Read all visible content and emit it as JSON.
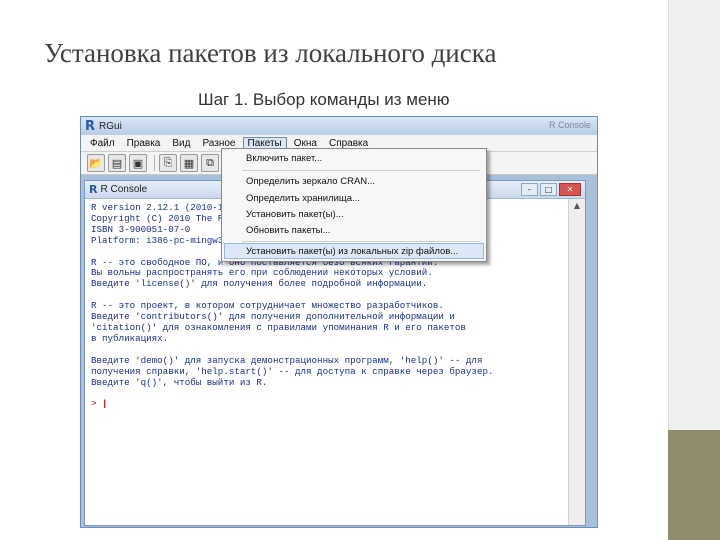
{
  "slide": {
    "title": "Установка пакетов из локального диска",
    "subtitle": "Шаг 1. Выбор команды из меню"
  },
  "rgui": {
    "title": "RGui",
    "title_right": "R Console",
    "menu": [
      "Файл",
      "Правка",
      "Вид",
      "Разное",
      "Пакеты",
      "Окна",
      "Справка"
    ],
    "active_menu": "Пакеты",
    "toolbar_icons": [
      "open-script-icon",
      "load-workspace-icon",
      "save-workspace-icon",
      "copy-icon",
      "paste-icon",
      "copy-paste-icon",
      "stop-icon",
      "print-icon"
    ]
  },
  "dropdown": {
    "items": [
      "Включить пакет...",
      "Определить зеркало CRAN...",
      "Определить хранилища...",
      "Установить пакет(ы)...",
      "Обновить пакеты...",
      "Установить пакет(ы) из локальных zip файлов..."
    ],
    "highlighted": "Установить пакет(ы) из локальных zip файлов..."
  },
  "console": {
    "title": "R Console",
    "lines": [
      "R version 2.12.1 (2010-12-16)",
      "Copyright (C) 2010 The R Foundation for Statistical Computing",
      "ISBN 3-900051-07-0",
      "Platform: i386-pc-mingw32/i386 (32-bit)",
      "",
      "R -- это свободное ПО, и оно поставляется безо всяких гарантий.",
      "Вы вольны распространять его при соблюдении некоторых условий.",
      "Введите 'license()' для получения более подробной информации.",
      "",
      "R -- это проект, в котором сотрудничает множество разработчиков.",
      "Введите 'contributors()' для получения дополнительной информации и",
      "'citation()' для ознакомления с правилами упоминания R и его пакетов",
      "в публикациях.",
      "",
      "Введите 'demo()' для запуска демонстрационных программ, 'help()' -- для",
      "получения справки, 'help.start()' -- для доступа к справке через браузер.",
      "Введите 'q()', чтобы выйти из R.",
      ""
    ],
    "prompt": ">"
  }
}
